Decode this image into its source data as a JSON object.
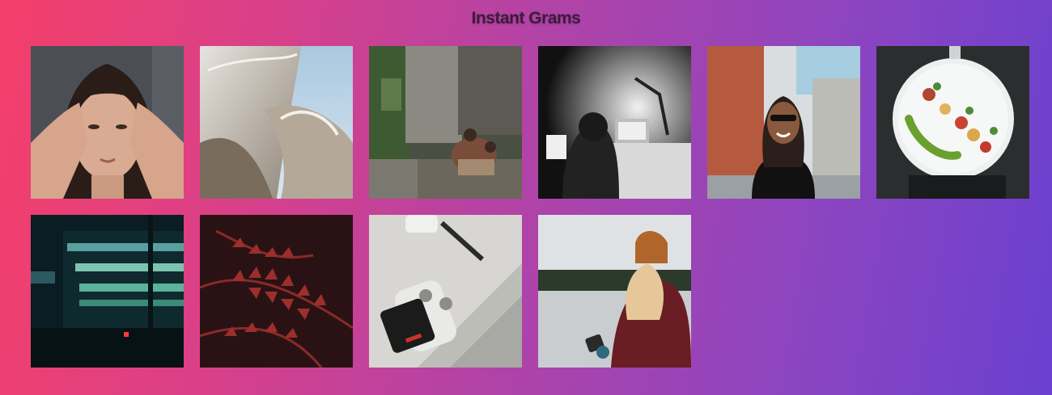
{
  "page": {
    "title": "Instant Grams"
  },
  "gallery": {
    "photos": [
      {
        "subject": "woman-portrait"
      },
      {
        "subject": "curved-metal-architecture"
      },
      {
        "subject": "family-on-steps"
      },
      {
        "subject": "person-at-desk-bw"
      },
      {
        "subject": "smiling-woman-street"
      },
      {
        "subject": "food-plate"
      },
      {
        "subject": "building-at-night"
      },
      {
        "subject": "red-fern"
      },
      {
        "subject": "drone-controller"
      },
      {
        "subject": "person-by-lake"
      }
    ]
  }
}
